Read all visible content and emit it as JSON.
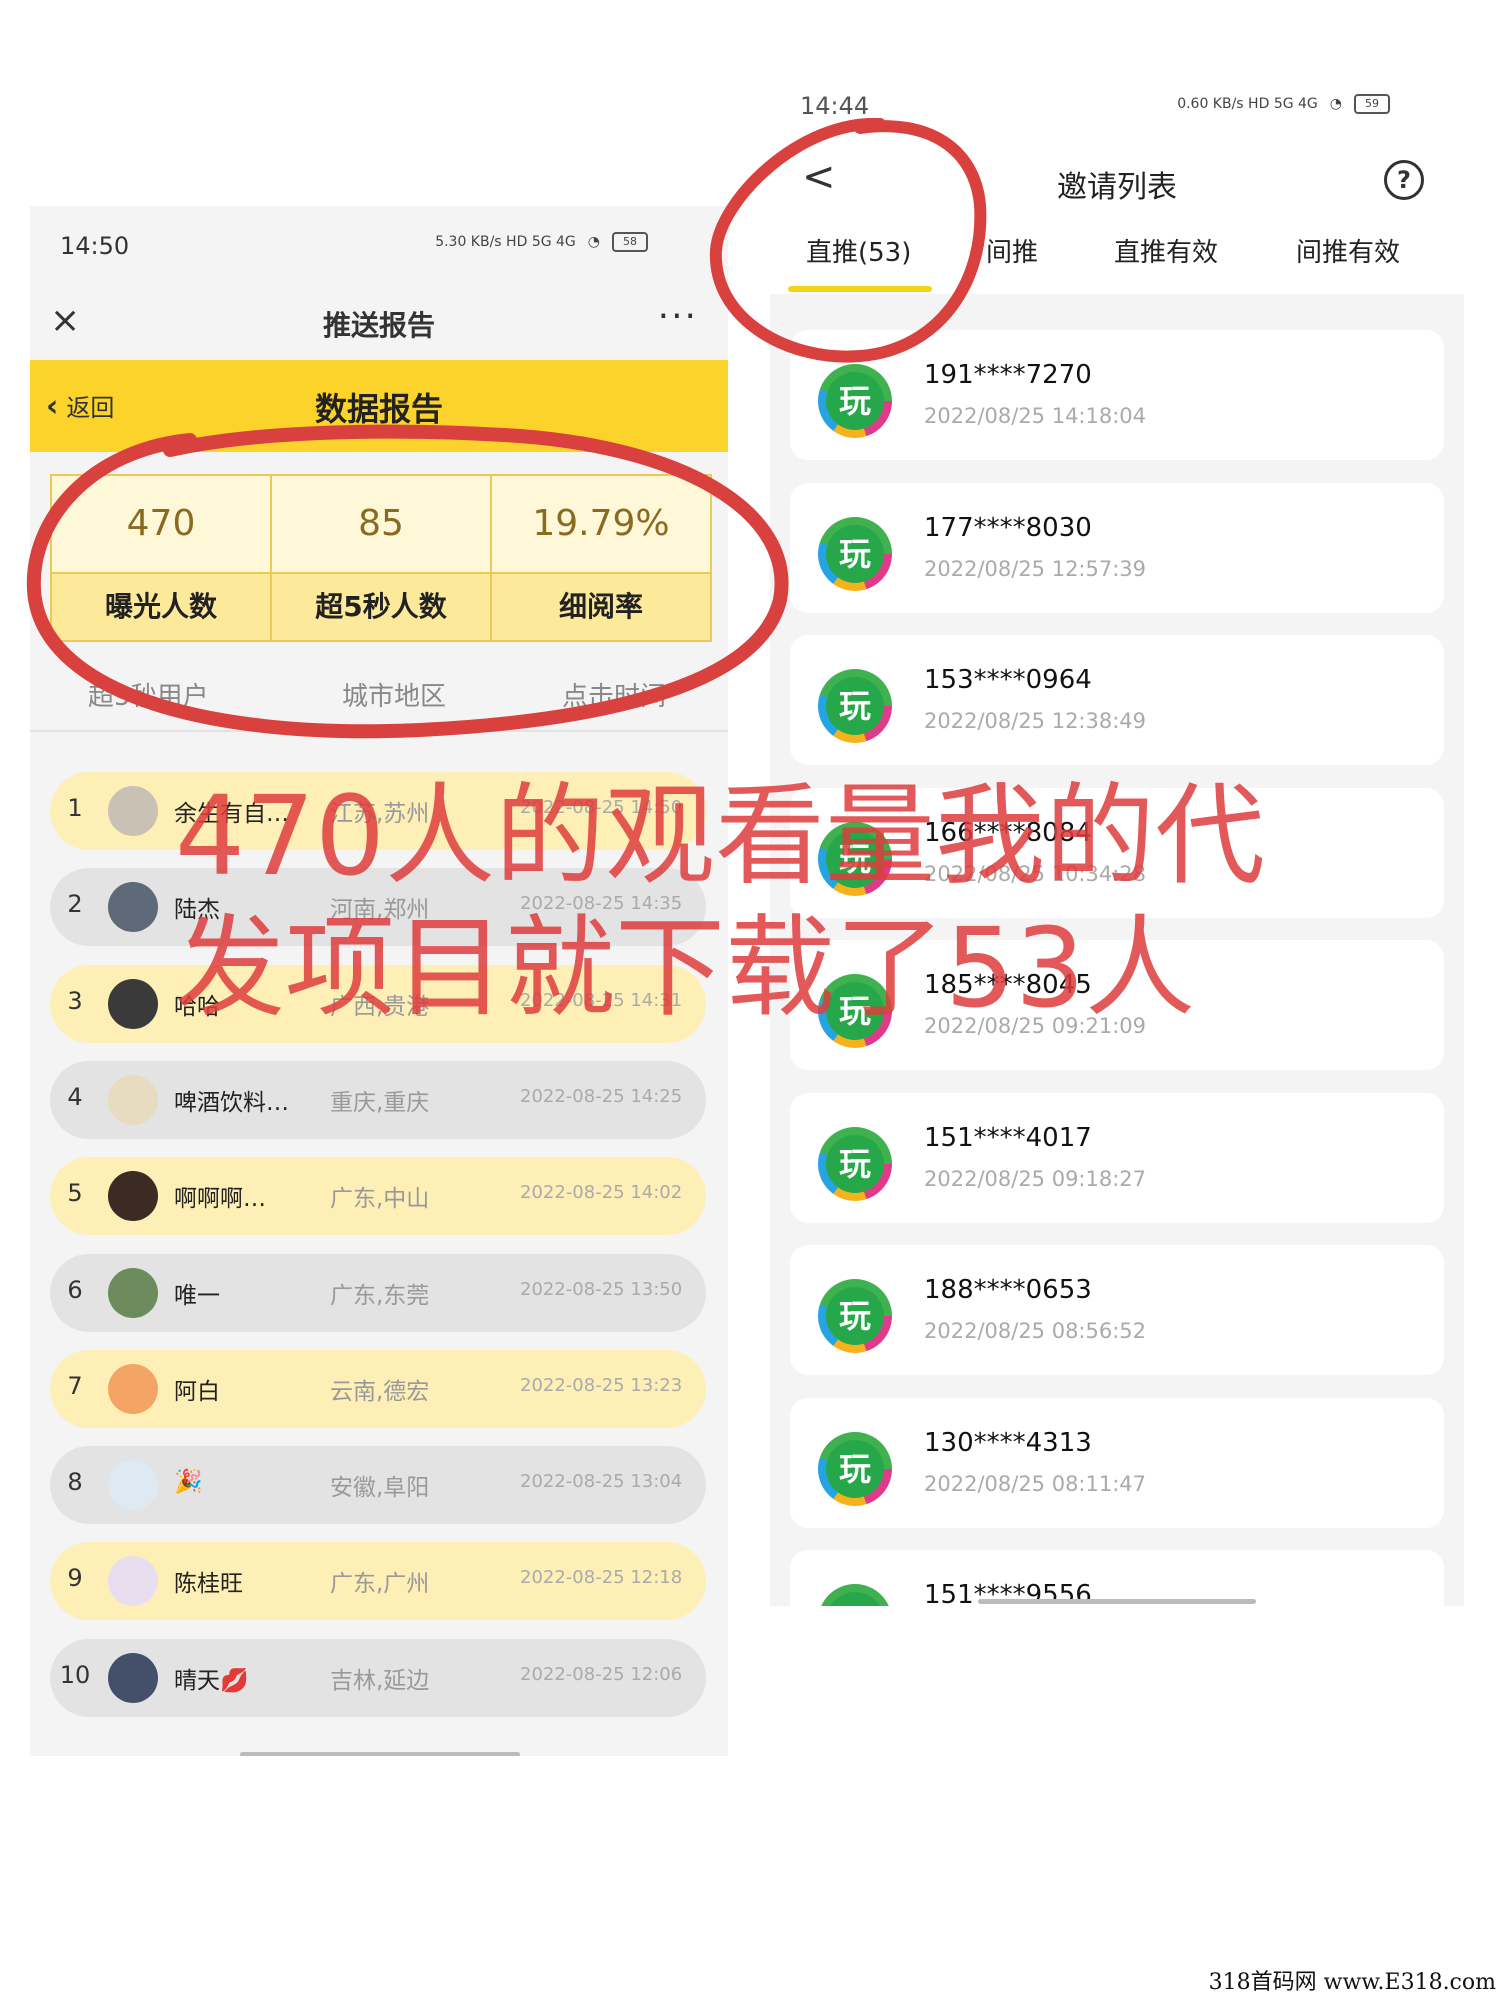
{
  "left_phone": {
    "status": {
      "time": "14:50",
      "network": "5.30 KB/s  HD  5G  4G",
      "battery": "58"
    },
    "nav": {
      "title": "推送报告",
      "close": "×",
      "more": "···"
    },
    "report_bar": {
      "back_label": "返回",
      "title": "数据报告"
    },
    "stats": [
      {
        "value": "470",
        "label": "曝光人数"
      },
      {
        "value": "85",
        "label": "超5秒人数"
      },
      {
        "value": "19.79%",
        "label": "细阅率"
      }
    ],
    "tabs": [
      "超5秒用户",
      "城市地区",
      "点击时间"
    ],
    "rows": [
      {
        "num": "1",
        "name": "余生有自…",
        "city": "江苏,苏州",
        "time": "2022-08-25 14:50",
        "avatar": "#c9c2b4"
      },
      {
        "num": "2",
        "name": "陆杰",
        "city": "河南,郑州",
        "time": "2022-08-25 14:35",
        "avatar": "#5e6a78"
      },
      {
        "num": "3",
        "name": "哈哈",
        "city": "广西,贵港",
        "time": "2022-08-25 14:31",
        "avatar": "#3a3a3a"
      },
      {
        "num": "4",
        "name": "啤酒饮料…",
        "city": "重庆,重庆",
        "time": "2022-08-25 14:25",
        "avatar": "#e8dcc0"
      },
      {
        "num": "5",
        "name": "啊啊啊…",
        "city": "广东,中山",
        "time": "2022-08-25 14:02",
        "avatar": "#3b2b22"
      },
      {
        "num": "6",
        "name": "唯一",
        "city": "广东,东莞",
        "time": "2022-08-25 13:50",
        "avatar": "#6c8c5e"
      },
      {
        "num": "7",
        "name": "阿白",
        "city": "云南,德宏",
        "time": "2022-08-25 13:23",
        "avatar": "#f4a565"
      },
      {
        "num": "8",
        "name": "🎉",
        "city": "安徽,阜阳",
        "time": "2022-08-25 13:04",
        "avatar": "#dfe9f2"
      },
      {
        "num": "9",
        "name": "陈桂旺",
        "city": "广东,广州",
        "time": "2022-08-25 12:18",
        "avatar": "#e8def0"
      },
      {
        "num": "10",
        "name": "晴天💋",
        "city": "吉林,延边",
        "time": "2022-08-25 12:06",
        "avatar": "#44506a"
      }
    ]
  },
  "right_phone": {
    "status": {
      "time": "14:44",
      "network": "0.60 KB/s  HD  5G  4G",
      "battery": "59"
    },
    "nav": {
      "title": "邀请列表",
      "back": "<",
      "help": "?"
    },
    "tabs": [
      "直推(53)",
      "间推",
      "直推有效",
      "间推有效"
    ],
    "app_icon_char": "玩",
    "invites": [
      {
        "phone": "191****7270",
        "date": "2022/08/25 14:18:04"
      },
      {
        "phone": "177****8030",
        "date": "2022/08/25 12:57:39"
      },
      {
        "phone": "153****0964",
        "date": "2022/08/25 12:38:49"
      },
      {
        "phone": "166****8084",
        "date": "2022/08/25 10:34:28"
      },
      {
        "phone": "185****8045",
        "date": "2022/08/25 09:21:09"
      },
      {
        "phone": "151****4017",
        "date": "2022/08/25 09:18:27"
      },
      {
        "phone": "188****0653",
        "date": "2022/08/25 08:56:52"
      },
      {
        "phone": "130****4313",
        "date": "2022/08/25 08:11:47"
      },
      {
        "phone": "151****9556",
        "date": ""
      }
    ]
  },
  "caption": {
    "line1": "470人的观看量我的代",
    "line2": "发项目就下载了53人"
  },
  "watermark": "318首码网 www.E318.com",
  "colors": {
    "accent_yellow": "#fcd32a",
    "annotation_red": "#d9413f"
  }
}
